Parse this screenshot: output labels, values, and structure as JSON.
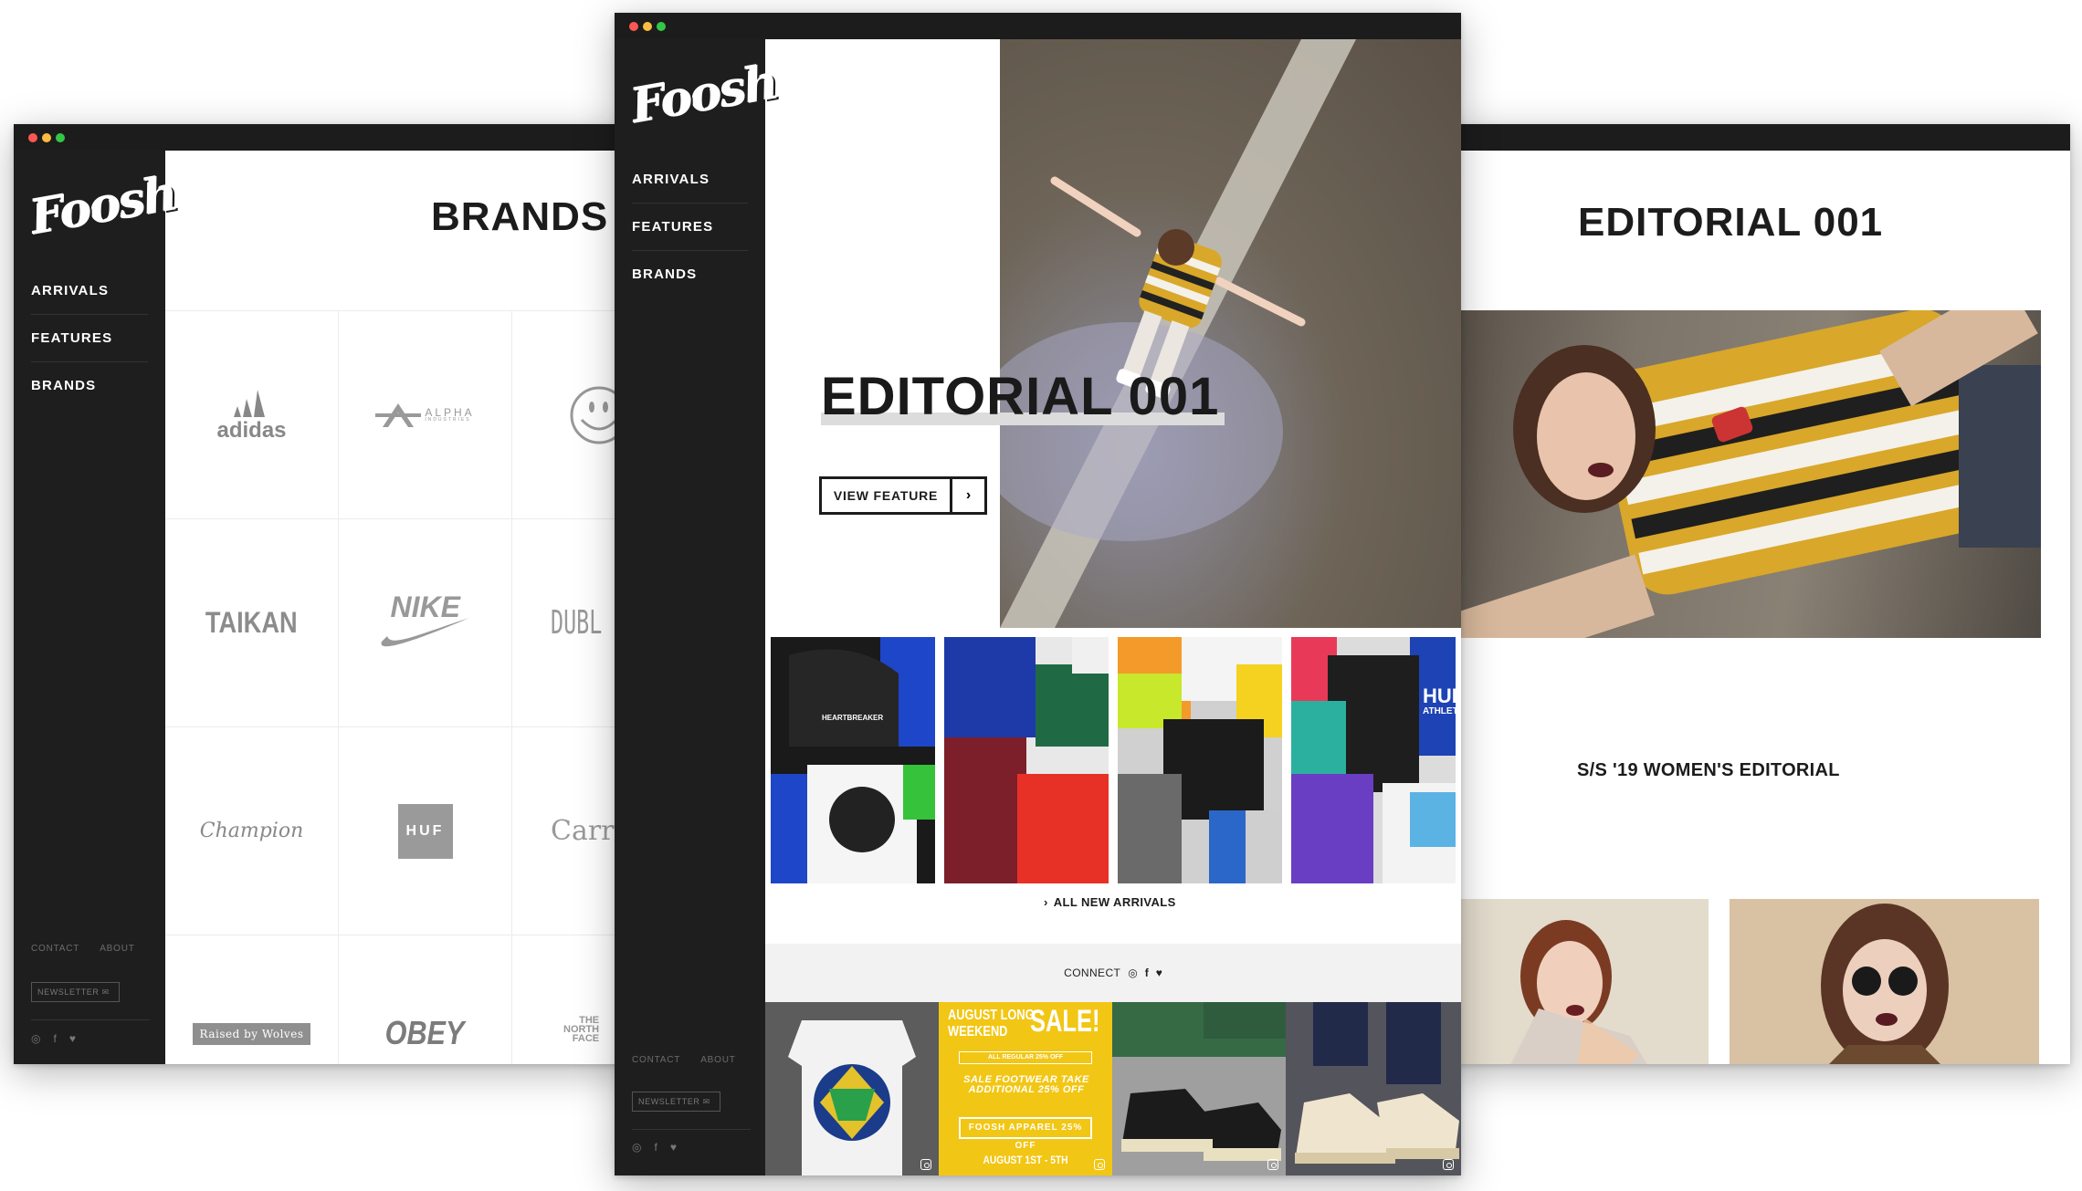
{
  "brand": {
    "logo_text": "Foosh"
  },
  "nav": {
    "items": [
      "ARRIVALS",
      "FEATURES",
      "BRANDS"
    ]
  },
  "footer": {
    "contact": "CONTACT",
    "about": "ABOUT",
    "newsletter": "NEWSLETTER",
    "social_icons": [
      "instagram-icon",
      "facebook-icon",
      "twitter-icon"
    ]
  },
  "brands_page": {
    "title": "BRANDS",
    "brands": [
      "adidas",
      "ALPHA",
      "INDUSTRIES",
      "TAIKAN",
      "NIKE",
      "DUBL",
      "Champion",
      "HUF",
      "Carr",
      "Raised by Wolves",
      "OBEY",
      "THE",
      "NORTH",
      "FACE"
    ]
  },
  "home_page": {
    "hero_title": "EDITORIAL 001",
    "view_feature": "VIEW FEATURE",
    "all_new_arrivals": "ALL NEW ARRIVALS",
    "connect": "CONNECT",
    "product_tile_text": [
      "HEARTBREAKER",
      "HUF",
      "ATHLETI"
    ],
    "promo": {
      "line1": "AUGUST LONG",
      "line2": "WEEKEND",
      "sale": "SALE!",
      "line3": "ALL REGULAR 25% OFF",
      "line4": "SALE FOOTWEAR TAKE ADDITIONAL 25% OFF",
      "line5": "FOOSH APPAREL 25% OFF",
      "dates": "AUGUST 1ST - 5TH"
    }
  },
  "editorial_page": {
    "title": "EDITORIAL 001",
    "subtitle": "S/S '19 WOMEN'S EDITORIAL"
  },
  "colors": {
    "sidebar": "#1e1e1e",
    "accent_yellow": "#f2c614",
    "titlebar": "#1c1c1c"
  }
}
